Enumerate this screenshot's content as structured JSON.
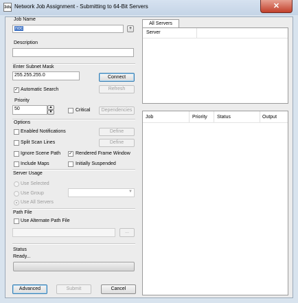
{
  "title": "Network Job Assignment - Submitting to 64-Bit Servers",
  "icon": "3ds-max-icon",
  "close_label": "✕",
  "job_name": {
    "label": "Job Name",
    "value": "noc",
    "add_label": "+"
  },
  "description": {
    "label": "Description",
    "value": ""
  },
  "subnet": {
    "label": "Enter Subnet Mask",
    "value": "255.255.255.0",
    "connect": "Connect"
  },
  "automatic_search": {
    "label": "Automatic Search",
    "checked": true,
    "refresh": "Refresh"
  },
  "priority": {
    "label": "Priority",
    "value": "50",
    "critical": "Critical",
    "dependencies": "Dependencies"
  },
  "options": {
    "label": "Options",
    "enabled_notifications": "Enabled Notifications",
    "split_scan_lines": "Split Scan Lines",
    "define1": "Define",
    "define2": "Define",
    "ignore_scene_path": "Ignore Scene Path",
    "rendered_frame_window": "Rendered Frame Window",
    "include_maps": "Include Maps",
    "initially_suspended": "Initially Suspended"
  },
  "server_usage": {
    "label": "Server Usage",
    "use_selected": "Use Selected",
    "use_group": "Use Group",
    "use_all_servers": "Use All Servers"
  },
  "path_file": {
    "label": "Path File",
    "use_alternate": "Use Alternate Path File",
    "browse": "..."
  },
  "status": {
    "label": "Status",
    "text": "Ready..."
  },
  "buttons": {
    "advanced": "Advanced",
    "submit": "Submit",
    "cancel": "Cancel"
  },
  "servers_tab": "All Servers",
  "servers_header": "Server",
  "jobs_columns": [
    "Job",
    "Priority",
    "Status",
    "Output"
  ]
}
